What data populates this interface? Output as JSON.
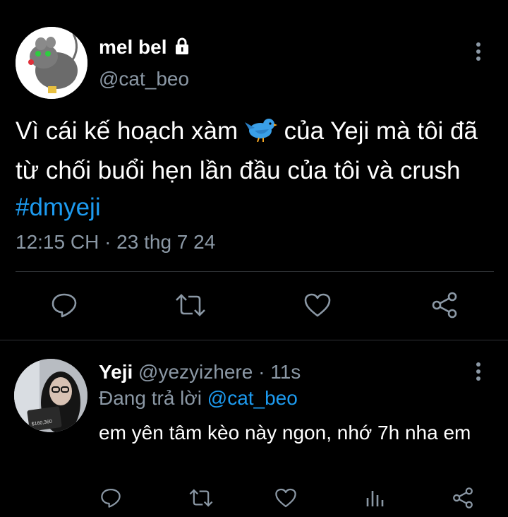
{
  "tweet": {
    "author_name": "mel bel",
    "author_handle": "@cat_beo",
    "text_before": "Vì cái kế hoạch xàm ",
    "text_middle": " của Yeji mà tôi đã từ chối buổi hẹn lần đầu của tôi và crush ",
    "hashtag": "#dmyeji",
    "timestamp": "12:15 CH · 23 thg 7 24"
  },
  "reply": {
    "author_name": "Yeji",
    "author_handle": "@yezyizhere",
    "time_ago": "· 11s",
    "replying_prefix": "Đang trả lời ",
    "replying_to": "@cat_beo",
    "text": "em yên tâm kèo này ngon, nhớ 7h nha em",
    "avatar_caption": "$160,360"
  },
  "icons": [
    "lock-icon",
    "more-icon",
    "bird-emoji-icon",
    "reply-icon",
    "retweet-icon",
    "like-icon",
    "share-icon",
    "analytics-icon"
  ],
  "colors": {
    "background": "#000000",
    "secondary_text": "#8b98a5",
    "link": "#1d9bf0",
    "divider": "#2f3336"
  }
}
